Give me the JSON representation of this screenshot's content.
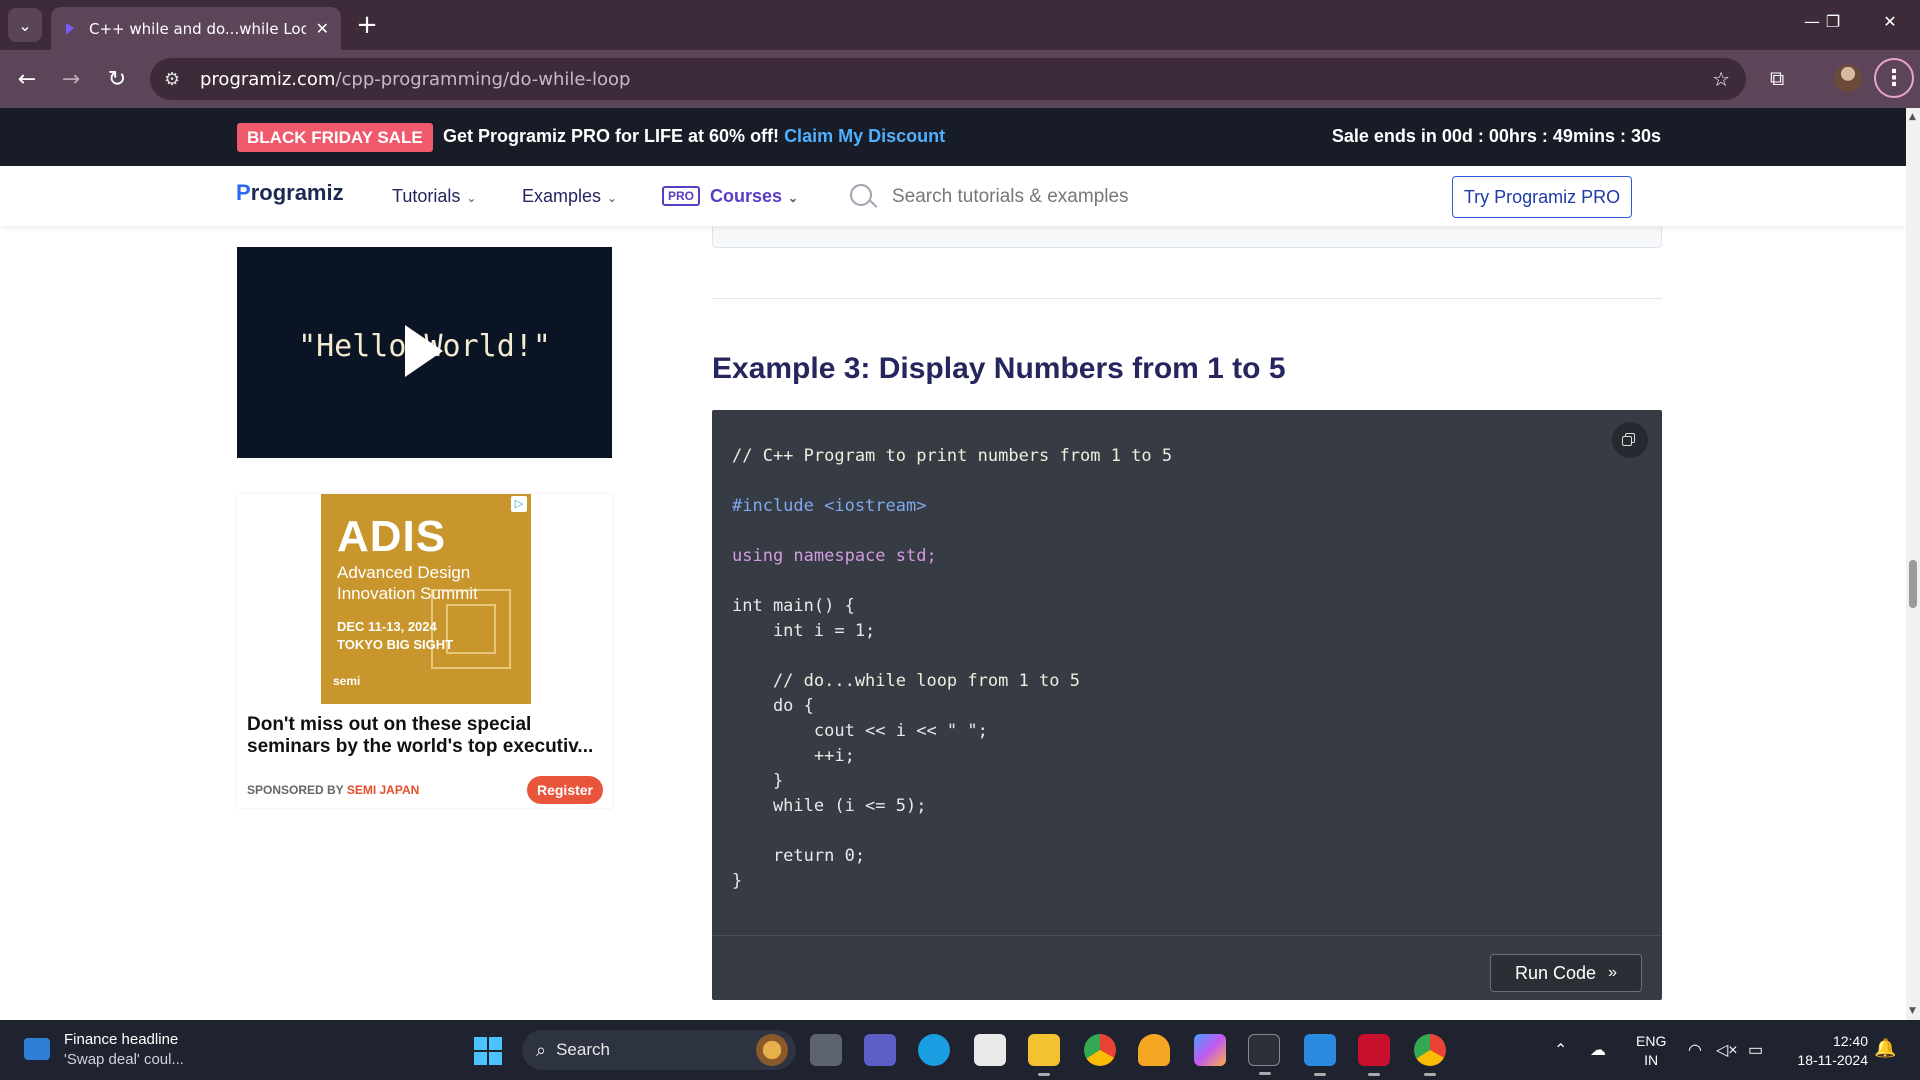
{
  "browser": {
    "tab_title": "C++ while and do...while Loop (",
    "tab_close": "✕",
    "new_tab": "+",
    "url_domain": "programiz.com",
    "url_path": "/cpp-programming/do-while-loop",
    "window_controls": {
      "minimize": "—",
      "restore": "❐",
      "close": "✕"
    }
  },
  "promo": {
    "badge": "BLACK FRIDAY SALE",
    "message": "Get Programiz PRO for LIFE at 60% off!",
    "cta": "Claim My Discount",
    "timer": "Sale ends in 00d : 00hrs : 49mins : 30s"
  },
  "nav": {
    "logo": "rogramiz",
    "logo_p": "P",
    "tutorials": "Tutorials",
    "examples": "Examples",
    "pro_badge": "PRO",
    "courses": "Courses",
    "search_placeholder": "Search tutorials & examples",
    "try_pro": "Try Programiz PRO"
  },
  "video": {
    "text": "\"Hello World!\""
  },
  "ad": {
    "brand": "ADIS",
    "subtitle": "Advanced Design Innovation Summit",
    "date": "DEC 11-13, 2024",
    "venue": "TOKYO BIG SIGHT",
    "logo": "semi",
    "headline": "Don't miss out on these special seminars by the world's top executiv...",
    "sponsored_by": "SPONSORED BY",
    "sponsor": "SEMI JAPAN",
    "register": "Register"
  },
  "main": {
    "example_title": "Example 3: Display Numbers from 1 to 5",
    "run_code": "Run Code",
    "code_lines": [
      "// C++ Program to print numbers from 1 to 5",
      "",
      "#include <iostream>",
      "",
      "using namespace std;",
      "",
      "int main() {",
      "    int i = 1;",
      "",
      "    // do...while loop from 1 to 5",
      "    do {",
      "        cout << i << \" \";",
      "        ++i;",
      "    }",
      "    while (i <= 5);",
      "",
      "    return 0;",
      "}"
    ]
  },
  "taskbar": {
    "widget_title": "Finance headline",
    "widget_sub": "'Swap deal' coul...",
    "search": "Search",
    "lang_1": "ENG",
    "lang_2": "IN",
    "time": "12:40",
    "date": "18-11-2024"
  },
  "colors": {
    "tabstrip": "#3d2b3a",
    "toolbar": "#5c4558",
    "promo_bg": "#181c26",
    "sale_badge": "#ef5a6c",
    "claim_link": "#4fb0ff",
    "heading": "#25265e",
    "code_bg": "#373c44"
  }
}
